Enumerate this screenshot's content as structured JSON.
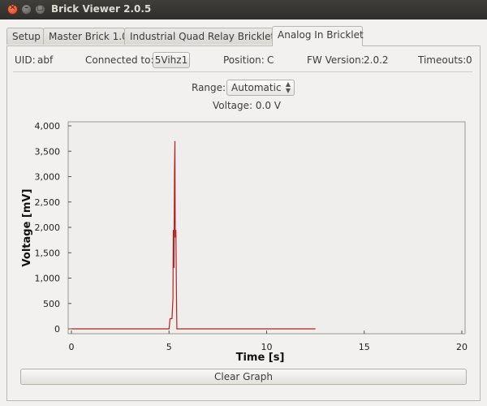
{
  "window": {
    "title": "Brick Viewer 2.0.5"
  },
  "tabs": [
    {
      "label": "Setup",
      "active": false
    },
    {
      "label": "Master Brick 1.0",
      "active": false
    },
    {
      "label": "Industrial Quad Relay Bricklet",
      "active": false
    },
    {
      "label": "Analog In Bricklet",
      "active": true
    }
  ],
  "info": {
    "uid_label": "UID:",
    "uid_value": "abf",
    "connected_label": "Connected to:",
    "connected_value": "5Vihz1",
    "position_label": "Position:",
    "position_value": "C",
    "fw_label": "FW Version:",
    "fw_value": "2.0.2",
    "timeouts_label": "Timeouts:",
    "timeouts_value": "0"
  },
  "range": {
    "label": "Range:",
    "selected": "Automatic"
  },
  "voltage_readout": "Voltage: 0.0 V",
  "clear_button": "Clear Graph",
  "chart_data": {
    "type": "line",
    "xlabel": "Time [s]",
    "ylabel": "Voltage [mV]",
    "xlim": [
      0,
      20
    ],
    "ylim": [
      0,
      4000
    ],
    "x_ticks": [
      0,
      5,
      10,
      15,
      20
    ],
    "y_ticks": [
      0,
      500,
      1000,
      1500,
      2000,
      2500,
      3000,
      3500,
      4000
    ],
    "y_tick_labels": [
      "0",
      "500",
      "1,000",
      "1,500",
      "2,000",
      "2,500",
      "3,000",
      "3,500",
      "4,000"
    ],
    "grid": false,
    "series": [
      {
        "color": "#b22222",
        "x": [
          0,
          5.0,
          5.05,
          5.15,
          5.2,
          5.22,
          5.25,
          5.28,
          5.3,
          5.32,
          5.35,
          5.38,
          5.4,
          5.45,
          5.5,
          12.5
        ],
        "y": [
          0,
          0,
          200,
          200,
          600,
          1950,
          1200,
          3100,
          3700,
          1800,
          1950,
          700,
          0,
          0,
          0,
          0
        ]
      }
    ]
  }
}
